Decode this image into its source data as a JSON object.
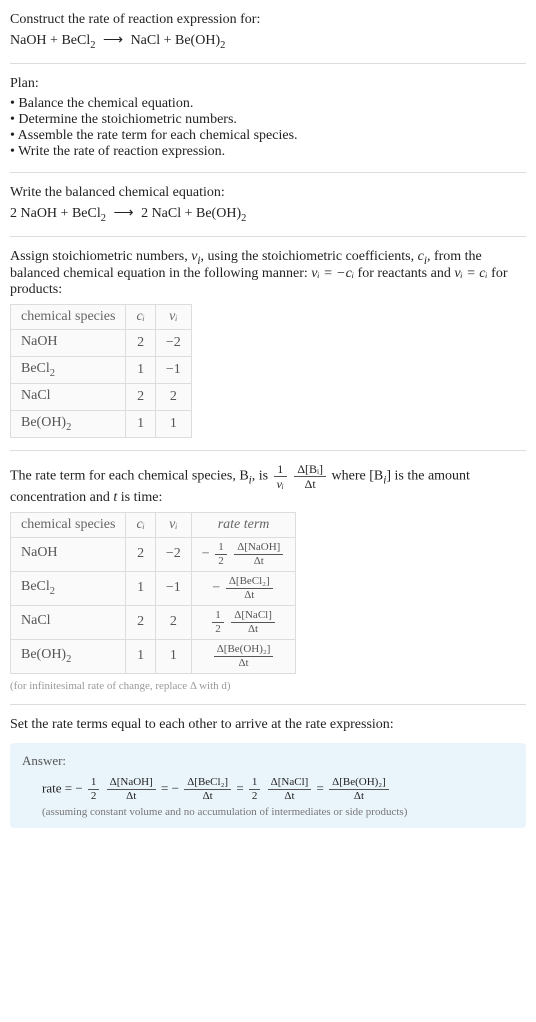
{
  "intro": {
    "prompt": "Construct the rate of reaction expression for:",
    "unbalanced_lhs": "NaOH + BeCl",
    "unbalanced_sub1": "2",
    "arrow": "⟶",
    "unbalanced_rhs1": "NaCl + Be(OH)",
    "unbalanced_sub2": "2"
  },
  "plan": {
    "heading": "Plan:",
    "items": [
      "Balance the chemical equation.",
      "Determine the stoichiometric numbers.",
      "Assemble the rate term for each chemical species.",
      "Write the rate of reaction expression."
    ]
  },
  "balanced": {
    "heading": "Write the balanced chemical equation:",
    "lhs": "2 NaOH + BeCl",
    "sub1": "2",
    "arrow": "⟶",
    "rhs": "2 NaCl + Be(OH)",
    "sub2": "2"
  },
  "assign": {
    "text_a": "Assign stoichiometric numbers, ",
    "nu_i": "ν",
    "sub_i": "i",
    "text_b": ", using the stoichiometric coefficients, ",
    "c_i": "c",
    "text_c": ", from the balanced chemical equation in the following manner: ",
    "rel1": "νᵢ = −cᵢ",
    "rel_reac": " for reactants and ",
    "rel2": "νᵢ = cᵢ",
    "rel_prod": " for products:"
  },
  "table1": {
    "headers": [
      "chemical species",
      "cᵢ",
      "νᵢ"
    ],
    "rows": [
      {
        "species": "NaOH",
        "sub": "",
        "c": "2",
        "nu": "−2"
      },
      {
        "species": "BeCl",
        "sub": "2",
        "c": "1",
        "nu": "−1"
      },
      {
        "species": "NaCl",
        "sub": "",
        "c": "2",
        "nu": "2"
      },
      {
        "species": "Be(OH)",
        "sub": "2",
        "c": "1",
        "nu": "1"
      }
    ]
  },
  "rateterm_intro": {
    "a": "The rate term for each chemical species, B",
    "b": ", is ",
    "c": " where [B",
    "d": "] is the amount concentration and ",
    "t": "t",
    "e": " is time:",
    "one": "1",
    "nu_i": "νᵢ",
    "dBi": "Δ[Bᵢ]",
    "dt": "Δt"
  },
  "table2": {
    "headers": [
      "chemical species",
      "cᵢ",
      "νᵢ",
      "rate term"
    ],
    "rows": [
      {
        "species": "NaOH",
        "sub": "",
        "c": "2",
        "nu": "−2",
        "neg": "−",
        "coef_num": "1",
        "coef_den": "2",
        "d_num": "Δ[NaOH]",
        "d_den": "Δt"
      },
      {
        "species": "BeCl",
        "sub": "2",
        "c": "1",
        "nu": "−1",
        "neg": "−",
        "coef_num": "",
        "coef_den": "",
        "d_num": "Δ[BeCl₂]",
        "d_den": "Δt"
      },
      {
        "species": "NaCl",
        "sub": "",
        "c": "2",
        "nu": "2",
        "neg": "",
        "coef_num": "1",
        "coef_den": "2",
        "d_num": "Δ[NaCl]",
        "d_den": "Δt"
      },
      {
        "species": "Be(OH)",
        "sub": "2",
        "c": "1",
        "nu": "1",
        "neg": "",
        "coef_num": "",
        "coef_den": "",
        "d_num": "Δ[Be(OH)₂]",
        "d_den": "Δt"
      }
    ],
    "hint": "(for infinitesimal rate of change, replace Δ with d)"
  },
  "final_sentence": "Set the rate terms equal to each other to arrive at the rate expression:",
  "answer": {
    "label": "Answer:",
    "rate_word": "rate = −",
    "eq": " = ",
    "terms": [
      {
        "neg": "",
        "coef_num": "1",
        "coef_den": "2",
        "d_num": "Δ[NaOH]",
        "d_den": "Δt"
      },
      {
        "neg": "−",
        "coef_num": "",
        "coef_den": "",
        "d_num": "Δ[BeCl₂]",
        "d_den": "Δt"
      },
      {
        "neg": "",
        "coef_num": "1",
        "coef_den": "2",
        "d_num": "Δ[NaCl]",
        "d_den": "Δt"
      },
      {
        "neg": "",
        "coef_num": "",
        "coef_den": "",
        "d_num": "Δ[Be(OH)₂]",
        "d_den": "Δt"
      }
    ],
    "note": "(assuming constant volume and no accumulation of intermediates or side products)"
  },
  "chart_data": {
    "type": "table",
    "title": "Stoichiometric numbers and rate terms for NaOH + BeCl2 → NaCl + Be(OH)2",
    "columns": [
      "chemical species",
      "c_i",
      "nu_i",
      "rate term"
    ],
    "rows": [
      [
        "NaOH",
        2,
        -2,
        "-(1/2) d[NaOH]/dt"
      ],
      [
        "BeCl2",
        1,
        -1,
        "- d[BeCl2]/dt"
      ],
      [
        "NaCl",
        2,
        2,
        "(1/2) d[NaCl]/dt"
      ],
      [
        "Be(OH)2",
        1,
        1,
        "d[Be(OH)2]/dt"
      ]
    ],
    "rate_expression": "rate = -(1/2) Δ[NaOH]/Δt = - Δ[BeCl2]/Δt = (1/2) Δ[NaCl]/Δt = Δ[Be(OH)2]/Δt"
  }
}
